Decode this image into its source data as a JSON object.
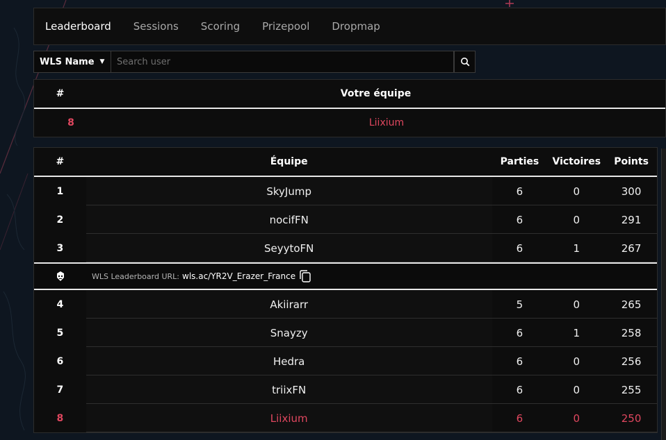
{
  "tabs": [
    {
      "label": "Leaderboard"
    },
    {
      "label": "Sessions"
    },
    {
      "label": "Scoring"
    },
    {
      "label": "Prizepool"
    },
    {
      "label": "Dropmap"
    }
  ],
  "search": {
    "select_value": "WLS Name",
    "placeholder": "Search user"
  },
  "team": {
    "header_rank": "#",
    "header_team": "Votre équipe",
    "rank": "8",
    "name": "Liixium"
  },
  "leaderboard": {
    "headers": {
      "rank": "#",
      "team": "Équipe",
      "games": "Parties",
      "wins": "Victoires",
      "points": "Points"
    },
    "rows_top": [
      {
        "rank": "1",
        "team": "SkyJump",
        "games": "6",
        "wins": "0",
        "points": "300"
      },
      {
        "rank": "2",
        "team": "nocifFN",
        "games": "6",
        "wins": "0",
        "points": "291"
      },
      {
        "rank": "3",
        "team": "SeyytoFN",
        "games": "6",
        "wins": "1",
        "points": "267"
      }
    ],
    "banner": {
      "label": "WLS Leaderboard URL:",
      "url": "wls.ac/YR2V_Erazer_France"
    },
    "rows_bottom": [
      {
        "rank": "4",
        "team": "Akiirarr",
        "games": "5",
        "wins": "0",
        "points": "265"
      },
      {
        "rank": "5",
        "team": "Snayzy",
        "games": "6",
        "wins": "1",
        "points": "258"
      },
      {
        "rank": "6",
        "team": "Hedra",
        "games": "6",
        "wins": "0",
        "points": "256"
      },
      {
        "rank": "7",
        "team": "triixFN",
        "games": "6",
        "wins": "0",
        "points": "255"
      },
      {
        "rank": "8",
        "team": "Liixium",
        "games": "6",
        "wins": "0",
        "points": "250"
      }
    ]
  },
  "colors": {
    "accent": "#e0475f",
    "background": "#0e1620",
    "panel": "#0d0d0d"
  }
}
